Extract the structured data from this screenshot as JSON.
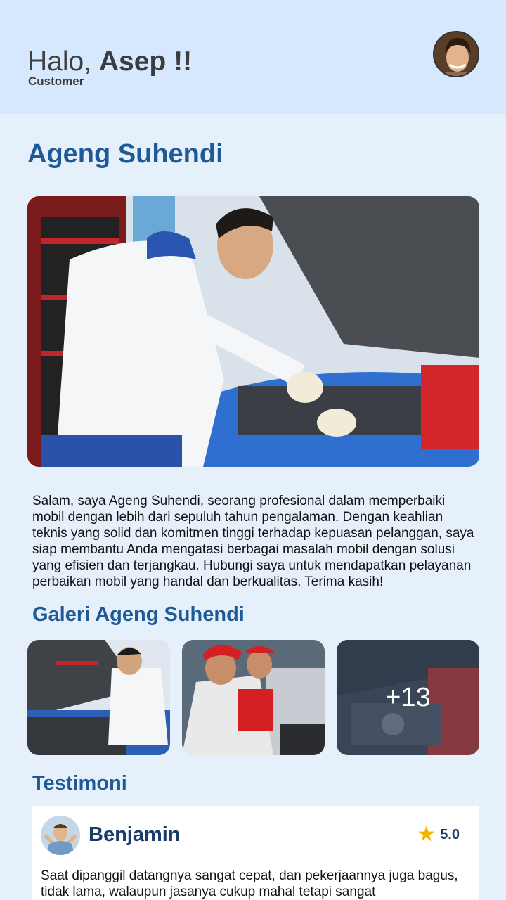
{
  "header": {
    "greeting_prefix": "Halo, ",
    "user_name": "Asep !!",
    "role": "Customer"
  },
  "profile": {
    "name": "Ageng Suhendi",
    "bio": "Salam, saya Ageng Suhendi, seorang profesional dalam memperbaiki mobil dengan lebih dari sepuluh tahun pengalaman. Dengan keahlian teknis yang solid dan komitmen tinggi terhadap kepuasan pelanggan, saya siap membantu Anda mengatasi berbagai masalah mobil dengan solusi yang efisien dan terjangkau. Hubungi saya untuk mendapatkan pelayanan perbaikan mobil yang handal dan berkualitas. Terima kasih!"
  },
  "gallery": {
    "title": "Galeri Ageng Suhendi",
    "more_count": "+13"
  },
  "testimonials": {
    "title": "Testimoni",
    "items": [
      {
        "name": "Benjamin",
        "rating": "5.0",
        "text": "Saat dipanggil datangnya sangat cepat, dan pekerjaannya juga bagus, tidak lama, walaupun jasanya cukup mahal tetapi sangat"
      }
    ]
  },
  "colors": {
    "accent": "#1f5a96",
    "header_bg": "#d6e8fd",
    "page_bg": "#e6f0fb",
    "star": "#f4b400"
  }
}
